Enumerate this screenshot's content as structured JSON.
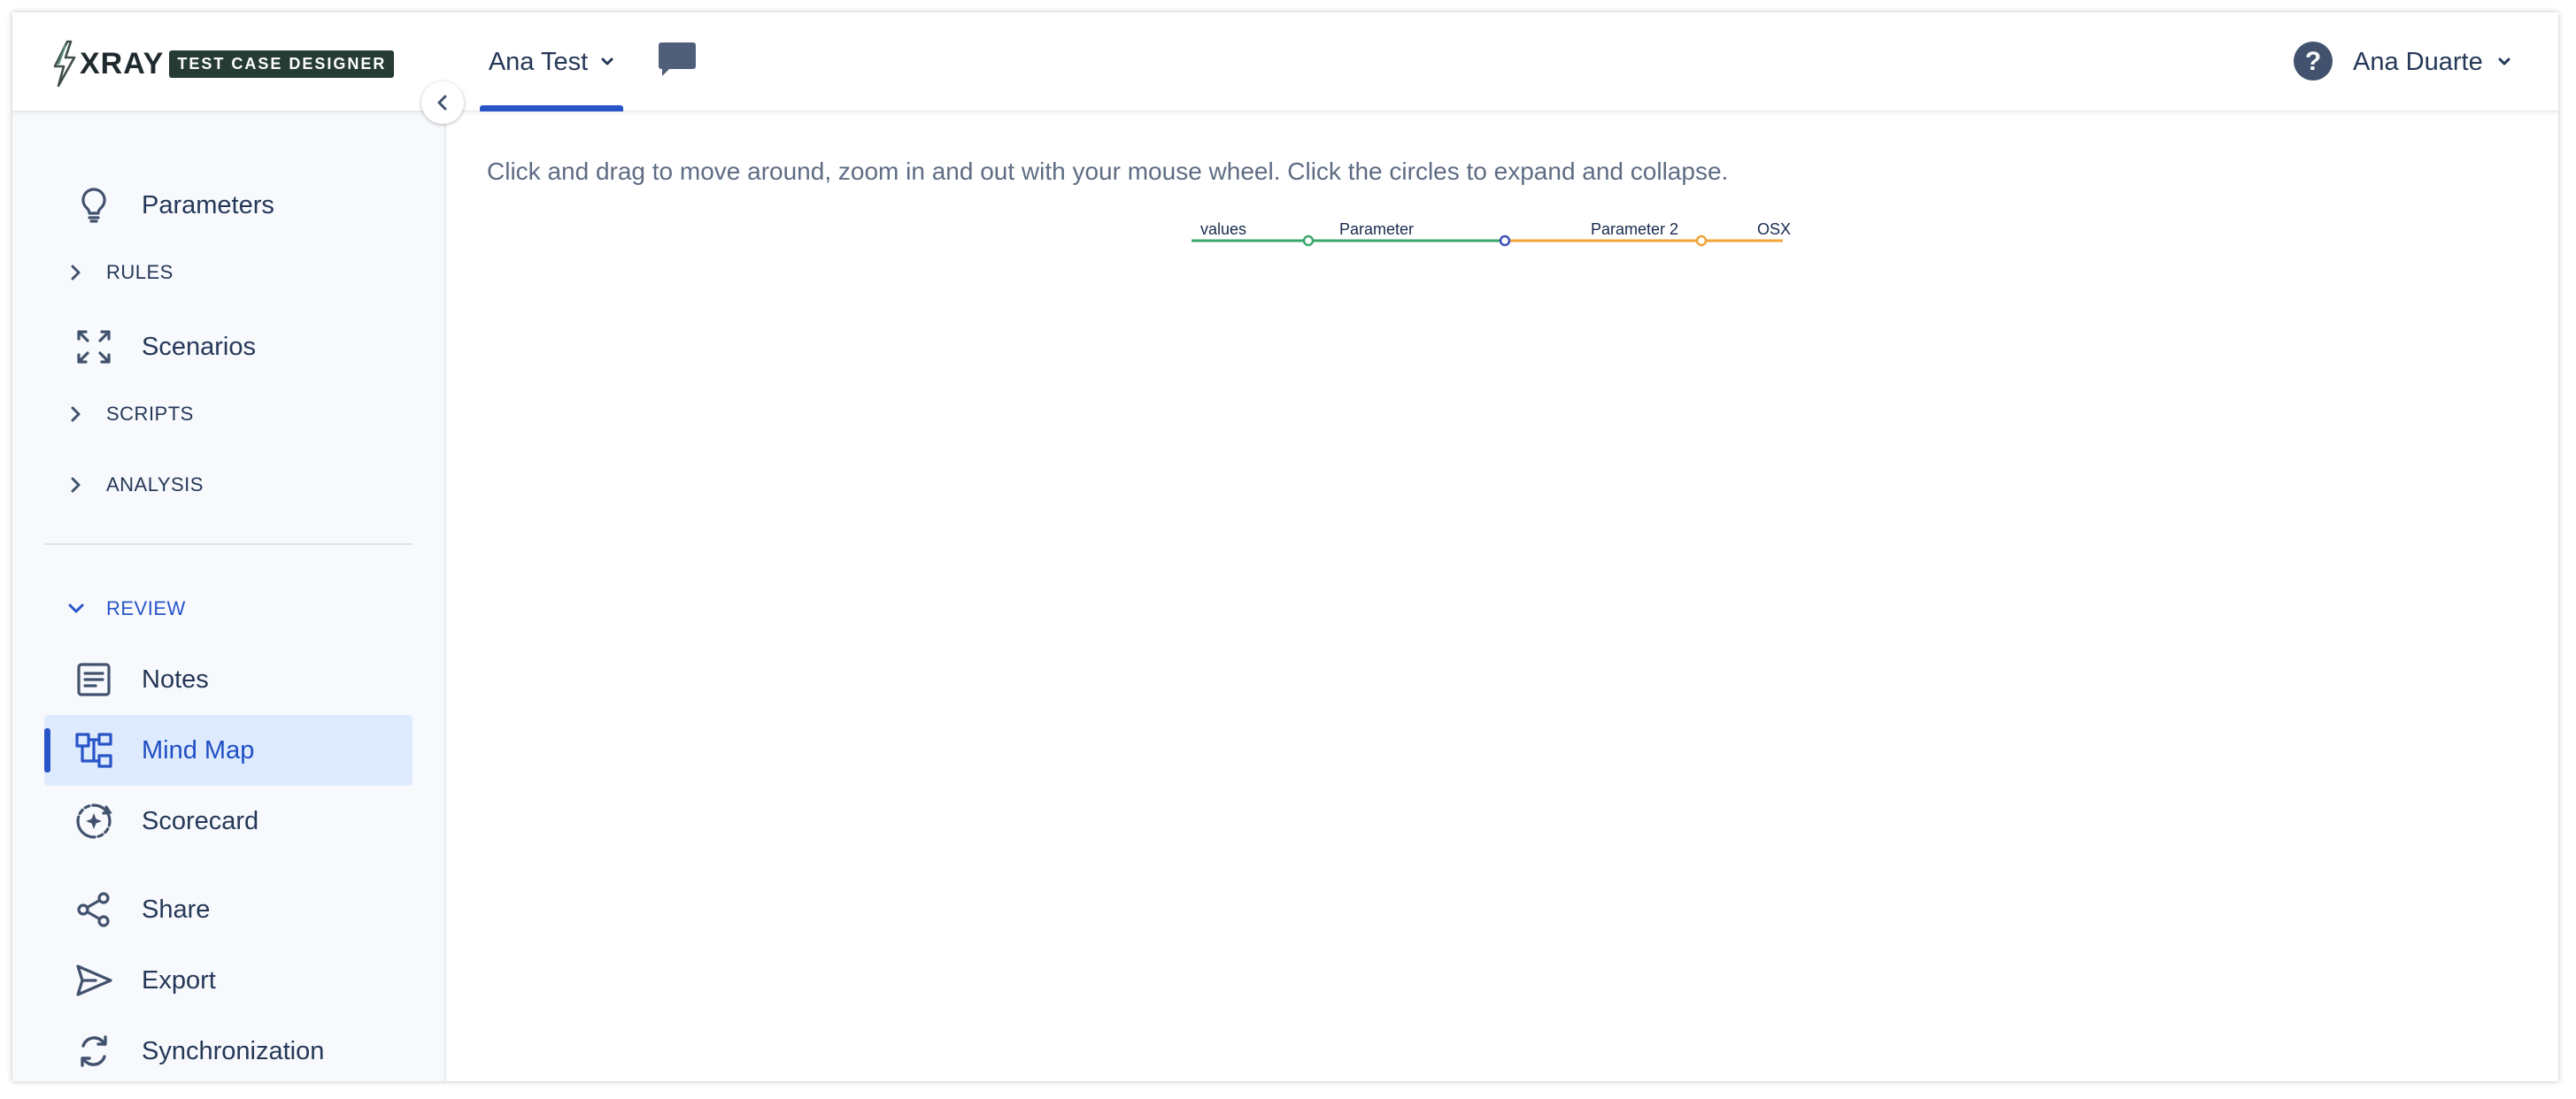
{
  "header": {
    "logo_word": "XRAY",
    "logo_badge": "TEST CASE DESIGNER",
    "project_name": "Ana Test",
    "user_name": "Ana Duarte"
  },
  "icons": {
    "logo": "xray-bolt-icon",
    "project_dropdown": "chevron-down-icon",
    "chat": "chat-bubble-icon",
    "help": "help-circle-icon",
    "user_dropdown": "chevron-down-icon",
    "collapse": "chevron-left-icon"
  },
  "sidebar": {
    "items": [
      {
        "label": "Parameters",
        "icon": "lightbulb-icon"
      },
      {
        "label": "RULES",
        "type": "section",
        "expanded": false
      },
      {
        "label": "Scenarios",
        "icon": "expand-arrows-icon"
      },
      {
        "label": "SCRIPTS",
        "type": "section",
        "expanded": false
      },
      {
        "label": "ANALYSIS",
        "type": "section",
        "expanded": false
      },
      {
        "label": "REVIEW",
        "type": "section",
        "expanded": true
      },
      {
        "label": "Notes",
        "icon": "notes-icon"
      },
      {
        "label": "Mind Map",
        "icon": "mind-map-icon",
        "active": true
      },
      {
        "label": "Scorecard",
        "icon": "scorecard-icon"
      },
      {
        "label": "Share",
        "icon": "share-icon"
      },
      {
        "label": "Export",
        "icon": "send-icon"
      },
      {
        "label": "Synchronization",
        "icon": "sync-icon"
      }
    ]
  },
  "main": {
    "instructions": "Click and drag to move around, zoom in and out with your mouse wheel. Click the circles to expand and collapse.",
    "mindmap": {
      "nodes": [
        {
          "label": "values",
          "color": "#3aa76d"
        },
        {
          "label": "Parameter",
          "color": "#3aa76d"
        },
        {
          "label": "Parameter 2",
          "color": "#f0a43a"
        },
        {
          "label": "OSX",
          "color": "#f0a43a"
        }
      ]
    }
  },
  "colors": {
    "accent": "#2855c8",
    "active_bg": "#deebff",
    "sidebar_bg": "#f7f9fc",
    "text": "#253858",
    "mm_green": "#3aa76d",
    "mm_orange": "#f0a43a",
    "mm_blue": "#3f51b5"
  }
}
